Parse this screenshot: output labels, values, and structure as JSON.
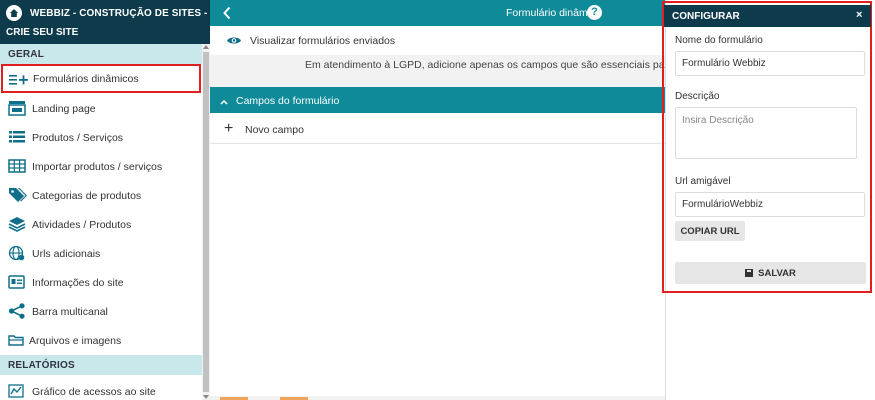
{
  "brand": {
    "line1": "WEBBIZ - CONSTRUÇÃO DE SITES -",
    "line2": "CRIE SEU SITE"
  },
  "sidebar": {
    "sections": [
      {
        "title": "GERAL"
      },
      {
        "title": "RELATÓRIOS"
      }
    ],
    "items": [
      {
        "label": "Formulários dinâmicos",
        "icon": "list-plus-icon",
        "active": true
      },
      {
        "label": "Landing page",
        "icon": "landing-page-icon"
      },
      {
        "label": "Produtos / Serviços",
        "icon": "list-icon"
      },
      {
        "label": "Importar produtos / serviços",
        "icon": "table-icon"
      },
      {
        "label": "Categorias de produtos",
        "icon": "tags-icon"
      },
      {
        "label": "Atividades / Produtos",
        "icon": "layers-icon"
      },
      {
        "label": "Urls adicionais",
        "icon": "globe-icon"
      },
      {
        "label": "Informações do site",
        "icon": "id-card-icon"
      },
      {
        "label": "Barra multicanal",
        "icon": "share-icon"
      },
      {
        "label": "Arquivos e imagens",
        "icon": "folder-icon"
      },
      {
        "label": "Gráfico de acessos ao site",
        "icon": "chart-icon"
      }
    ]
  },
  "main": {
    "title": "Formulário dinâmic",
    "view_submissions": "Visualizar formulários enviados",
    "lgpd_notice": "Em atendimento à LGPD, adicione apenas os campos que são essenciais para o seu co",
    "fields_section": "Campos do formulário",
    "new_field": "Novo campo"
  },
  "config": {
    "title": "CONFIGURAR",
    "close": "×",
    "name_label": "Nome do formulário",
    "name_value": "Formulário Webbiz",
    "description_label": "Descrição",
    "description_placeholder": "Insira Descrição",
    "url_label": "Url amigável",
    "url_value": "FormulárioWebbiz",
    "copy_url": "COPIAR URL",
    "save": "SALVAR"
  },
  "colors": {
    "dark": "#0d3b4c",
    "teal": "#0f8a99",
    "section": "#c8e8ec",
    "highlight": "#e0201e",
    "icon": "#0f6f8a"
  }
}
